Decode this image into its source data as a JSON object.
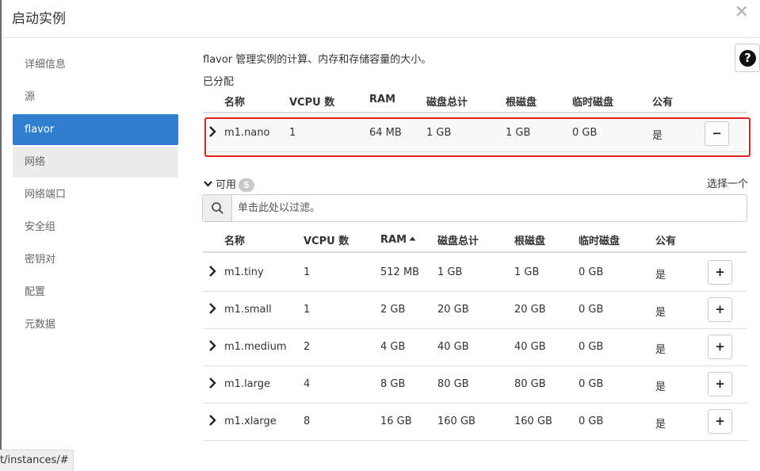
{
  "dialog": {
    "title": "启动实例",
    "close_glyph": "×"
  },
  "sidebar": {
    "items": [
      {
        "label": "详细信息",
        "state": ""
      },
      {
        "label": "源",
        "state": ""
      },
      {
        "label": "flavor",
        "state": "active"
      },
      {
        "label": "网络",
        "state": "hover"
      },
      {
        "label": "网络端口",
        "state": ""
      },
      {
        "label": "安全组",
        "state": ""
      },
      {
        "label": "密钥对",
        "state": ""
      },
      {
        "label": "配置",
        "state": ""
      },
      {
        "label": "元数据",
        "state": ""
      }
    ]
  },
  "help": {
    "glyph": "?"
  },
  "main": {
    "description": "flavor 管理实例的计算、内存和存储容量的大小。",
    "allocated_label": "已分配",
    "columns": [
      "名称",
      "VCPU 数",
      "RAM",
      "磁盘总计",
      "根磁盘",
      "临时磁盘",
      "公有"
    ],
    "allocated": [
      {
        "name": "m1.nano",
        "vcpu": "1",
        "ram": "64 MB",
        "disk": "1 GB",
        "root": "1 GB",
        "ephemeral": "0 GB",
        "public": "是",
        "action": "−"
      }
    ],
    "available_label": "可用",
    "available_count": "5",
    "select_one": "选择一个",
    "filter_placeholder": "单击此处以过滤。",
    "available": [
      {
        "name": "m1.tiny",
        "vcpu": "1",
        "ram": "512 MB",
        "disk": "1 GB",
        "root": "1 GB",
        "ephemeral": "0 GB",
        "public": "是",
        "action": "+"
      },
      {
        "name": "m1.small",
        "vcpu": "1",
        "ram": "2 GB",
        "disk": "20 GB",
        "root": "20 GB",
        "ephemeral": "0 GB",
        "public": "是",
        "action": "+"
      },
      {
        "name": "m1.medium",
        "vcpu": "2",
        "ram": "4 GB",
        "disk": "40 GB",
        "root": "40 GB",
        "ephemeral": "0 GB",
        "public": "是",
        "action": "+"
      },
      {
        "name": "m1.large",
        "vcpu": "4",
        "ram": "8 GB",
        "disk": "80 GB",
        "root": "80 GB",
        "ephemeral": "0 GB",
        "public": "是",
        "action": "+"
      },
      {
        "name": "m1.xlarge",
        "vcpu": "8",
        "ram": "16 GB",
        "disk": "160 GB",
        "root": "160 GB",
        "ephemeral": "0 GB",
        "public": "是",
        "action": "+"
      }
    ]
  },
  "status_bar": {
    "url": "t/instances/#"
  },
  "colors": {
    "accent": "#2f7fce",
    "highlight": "#e02020",
    "hover": "#ececec"
  }
}
